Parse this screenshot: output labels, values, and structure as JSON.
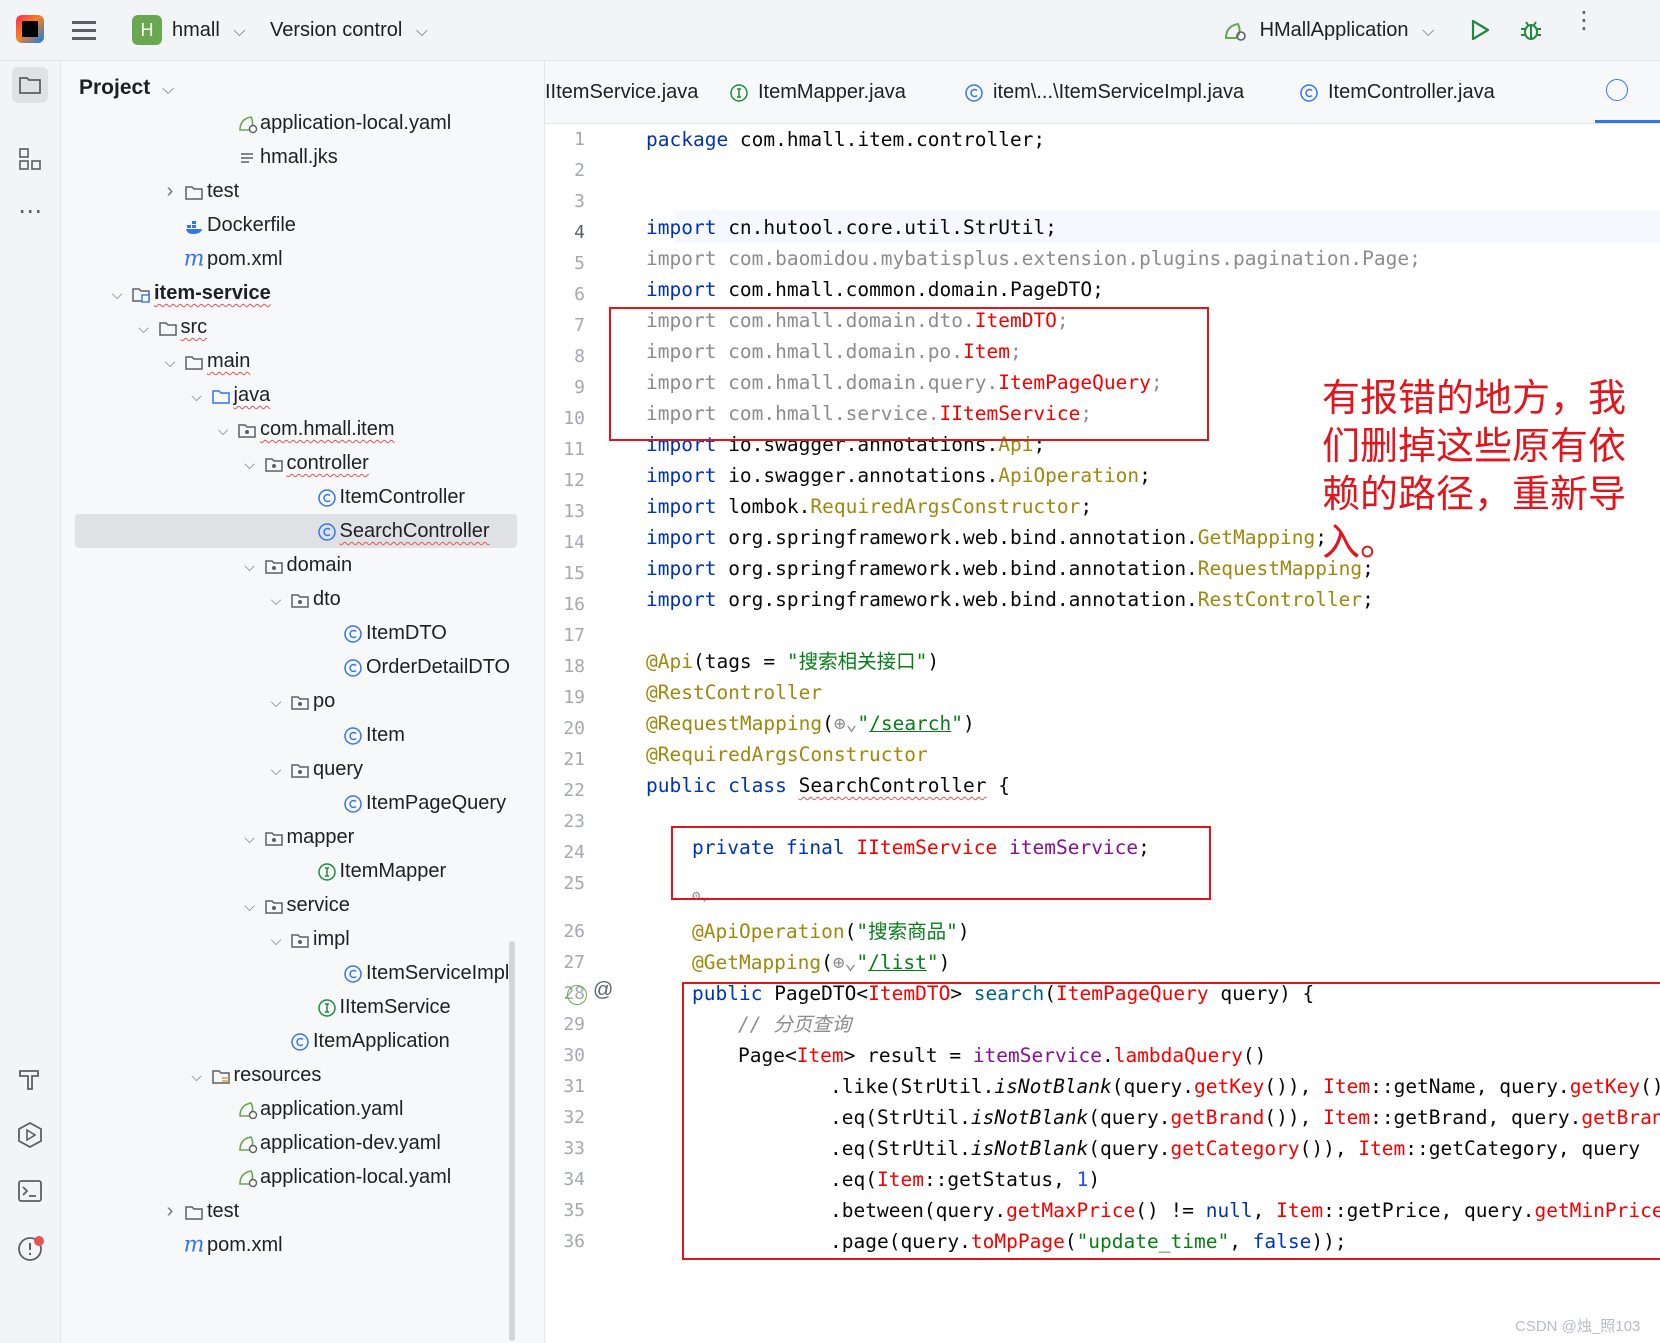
{
  "topbar": {
    "project_badge": "H",
    "project_name": "hmall",
    "vcs_label": "Version control",
    "run_config": "HMallApplication"
  },
  "project_panel": {
    "title": "Project",
    "tree": [
      {
        "label": "application-local.yaml",
        "icon": "yaml-icon",
        "indent": 6
      },
      {
        "label": "hmall.jks",
        "icon": "file-lines-icon",
        "indent": 6
      },
      {
        "label": "test",
        "icon": "folder-icon",
        "indent": 4,
        "chev": ">"
      },
      {
        "label": "Dockerfile",
        "icon": "docker-icon",
        "indent": 4
      },
      {
        "label": "pom.xml",
        "icon": "maven-icon",
        "indent": 4
      },
      {
        "label": "item-service",
        "icon": "module-folder-icon",
        "indent": 2,
        "chev": "v",
        "bold": true,
        "squig": true
      },
      {
        "label": "src",
        "icon": "folder-icon",
        "indent": 3,
        "chev": "v",
        "squig": true
      },
      {
        "label": "main",
        "icon": "folder-icon",
        "indent": 4,
        "chev": "v",
        "squig": true
      },
      {
        "label": "java",
        "icon": "source-folder-icon",
        "indent": 5,
        "chev": "v",
        "squig": true
      },
      {
        "label": "com.hmall.item",
        "icon": "package-icon",
        "indent": 6,
        "chev": "v",
        "squig": true
      },
      {
        "label": "controller",
        "icon": "package-icon",
        "indent": 7,
        "chev": "v",
        "squig": true
      },
      {
        "label": "ItemController",
        "icon": "class-icon",
        "indent": 9
      },
      {
        "label": "SearchController",
        "icon": "class-icon",
        "indent": 9,
        "selected": true,
        "squig": true
      },
      {
        "label": "domain",
        "icon": "package-icon",
        "indent": 7,
        "chev": "v"
      },
      {
        "label": "dto",
        "icon": "package-icon",
        "indent": 8,
        "chev": "v"
      },
      {
        "label": "ItemDTO",
        "icon": "class-icon",
        "indent": 10
      },
      {
        "label": "OrderDetailDTO",
        "icon": "class-icon",
        "indent": 10
      },
      {
        "label": "po",
        "icon": "package-icon",
        "indent": 8,
        "chev": "v"
      },
      {
        "label": "Item",
        "icon": "class-icon",
        "indent": 10
      },
      {
        "label": "query",
        "icon": "package-icon",
        "indent": 8,
        "chev": "v"
      },
      {
        "label": "ItemPageQuery",
        "icon": "class-icon",
        "indent": 10
      },
      {
        "label": "mapper",
        "icon": "package-icon",
        "indent": 7,
        "chev": "v"
      },
      {
        "label": "ItemMapper",
        "icon": "interface-icon",
        "indent": 9
      },
      {
        "label": "service",
        "icon": "package-icon",
        "indent": 7,
        "chev": "v"
      },
      {
        "label": "impl",
        "icon": "package-icon",
        "indent": 8,
        "chev": "v"
      },
      {
        "label": "ItemServiceImpl",
        "icon": "class-icon",
        "indent": 10
      },
      {
        "label": "IItemService",
        "icon": "interface-icon",
        "indent": 9
      },
      {
        "label": "ItemApplication",
        "icon": "class-icon",
        "indent": 8
      },
      {
        "label": "resources",
        "icon": "resources-folder-icon",
        "indent": 5,
        "chev": "v"
      },
      {
        "label": "application.yaml",
        "icon": "yaml-icon",
        "indent": 6
      },
      {
        "label": "application-dev.yaml",
        "icon": "yaml-icon",
        "indent": 6
      },
      {
        "label": "application-local.yaml",
        "icon": "yaml-icon",
        "indent": 6
      },
      {
        "label": "test",
        "icon": "folder-icon",
        "indent": 4,
        "chev": ">"
      },
      {
        "label": "pom.xml",
        "icon": "maven-icon",
        "indent": 4
      }
    ]
  },
  "tabs": [
    {
      "label": "IItemService.java",
      "icon": "interface-icon"
    },
    {
      "label": "ItemMapper.java",
      "icon": "interface-icon"
    },
    {
      "label": "item\\...\\ItemServiceImpl.java",
      "icon": "class-icon"
    },
    {
      "label": "ItemController.java",
      "icon": "class-icon"
    }
  ],
  "editor": {
    "line_numbers": [
      "1",
      "2",
      "3",
      "4",
      "5",
      "6",
      "7",
      "8",
      "9",
      "10",
      "11",
      "12",
      "13",
      "14",
      "15",
      "16",
      "17",
      "18",
      "19",
      "20",
      "21",
      "22",
      "23",
      "24",
      "25",
      "26",
      "27",
      "28",
      "29",
      "30",
      "31",
      "32",
      "33",
      "34",
      "35",
      "36"
    ]
  },
  "annotation_note": "有报错的地方，我们删掉这些原有依赖的路径，重新导入。",
  "watermark": "CSDN @烛_照103"
}
